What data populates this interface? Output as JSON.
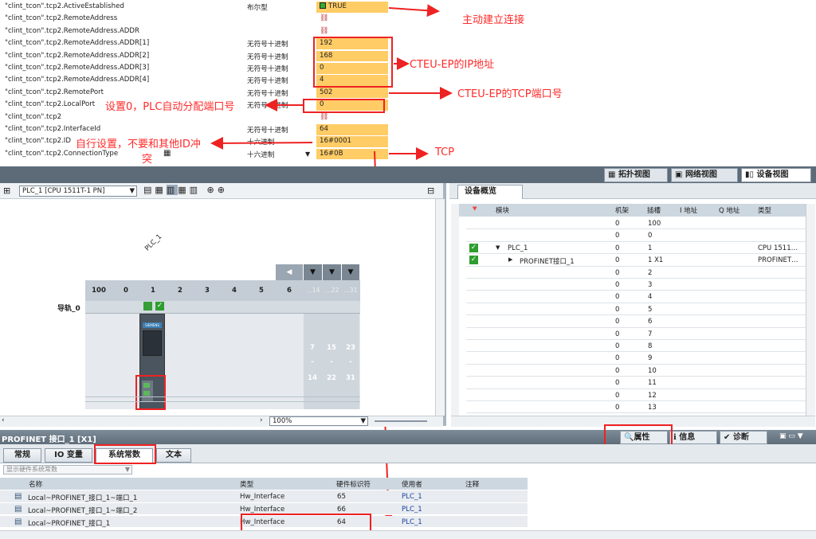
{
  "vars": [
    {
      "name": "\"clint_tcon\".tcp2.ActiveEstablished",
      "type": "布尔型",
      "value": "TRUE",
      "bool": true
    },
    {
      "name": "\"clint_tcon\".tcp2.RemoteAddress",
      "type": "",
      "value": ""
    },
    {
      "name": "\"clint_tcon\".tcp2.RemoteAddress.ADDR",
      "type": "",
      "value": ""
    },
    {
      "name": "\"clint_tcon\".tcp2.RemoteAddress.ADDR[1]",
      "type": "无符号十进制",
      "value": "192"
    },
    {
      "name": "\"clint_tcon\".tcp2.RemoteAddress.ADDR[2]",
      "type": "无符号十进制",
      "value": "168"
    },
    {
      "name": "\"clint_tcon\".tcp2.RemoteAddress.ADDR[3]",
      "type": "无符号十进制",
      "value": "0"
    },
    {
      "name": "\"clint_tcon\".tcp2.RemoteAddress.ADDR[4]",
      "type": "无符号十进制",
      "value": "4"
    },
    {
      "name": "\"clint_tcon\".tcp2.RemotePort",
      "type": "无符号十进制",
      "value": "502"
    },
    {
      "name": "\"clint_tcon\".tcp2.LocalPort",
      "type": "无符号十进制",
      "value": "0"
    },
    {
      "name": "\"clint_tcon\".tcp2",
      "type": "",
      "value": ""
    },
    {
      "name": "\"clint_tcon\".tcp2.InterfaceId",
      "type": "无符号十进制",
      "value": "64"
    },
    {
      "name": "\"clint_tcon\".tcp2.ID",
      "type": "十六进制",
      "value": "16#0001"
    },
    {
      "name": "\"clint_tcon\".tcp2.ConnectionType",
      "type": "十六进制",
      "value": "16#0B"
    }
  ],
  "annotations": {
    "active": "主动建立连接",
    "ip": "CTEU-EP的IP地址",
    "port": "CTEU-EP的TCP端口号",
    "local": "设置0，PLC自动分配端口号",
    "id_line1": "自行设置，不要和其他ID冲",
    "id_line2": "突",
    "tcp": "TCP"
  },
  "view_tabs": {
    "topology": "拓扑视图",
    "network": "网络视图",
    "device": "设备视图"
  },
  "device_view": {
    "plc_select": "PLC_1 [CPU 1511T-1 PN]",
    "zoom": "100%",
    "plc_label": "PLC_1",
    "rail_label": "导轨_0",
    "slot_headers": [
      "100",
      "0",
      "1",
      "2",
      "3",
      "4",
      "5",
      "6",
      "...14",
      "...22",
      "...31"
    ],
    "ext_top": [
      "7",
      "15",
      "23"
    ],
    "ext_dash": [
      "-",
      "-",
      "-"
    ],
    "ext_bot": [
      "14",
      "22",
      "31"
    ],
    "cpu_text": "SIEMENS",
    "scroll_left": "‹",
    "scroll_right": "›"
  },
  "overview": {
    "title": "设备概览",
    "headers": {
      "module": "模块",
      "rack": "机架",
      "slot": "插槽",
      "iaddr": "I 地址",
      "qaddr": "Q 地址",
      "type": "类型"
    },
    "rows": [
      {
        "module": "",
        "rack": "0",
        "slot": "100",
        "type": "",
        "check": false,
        "indent": 0,
        "arrow": ""
      },
      {
        "module": "",
        "rack": "0",
        "slot": "0",
        "type": "",
        "check": false,
        "indent": 0,
        "arrow": ""
      },
      {
        "module": "PLC_1",
        "rack": "0",
        "slot": "1",
        "type": "CPU 1511…",
        "check": true,
        "indent": 1,
        "arrow": "▼"
      },
      {
        "module": "PROFINET接口_1",
        "rack": "0",
        "slot": "1 X1",
        "type": "PROFINET…",
        "check": true,
        "indent": 2,
        "arrow": "▶"
      },
      {
        "module": "",
        "rack": "0",
        "slot": "2",
        "type": "",
        "check": false,
        "indent": 0,
        "arrow": ""
      },
      {
        "module": "",
        "rack": "0",
        "slot": "3",
        "type": "",
        "check": false,
        "indent": 0,
        "arrow": ""
      },
      {
        "module": "",
        "rack": "0",
        "slot": "4",
        "type": "",
        "check": false,
        "indent": 0,
        "arrow": ""
      },
      {
        "module": "",
        "rack": "0",
        "slot": "5",
        "type": "",
        "check": false,
        "indent": 0,
        "arrow": ""
      },
      {
        "module": "",
        "rack": "0",
        "slot": "6",
        "type": "",
        "check": false,
        "indent": 0,
        "arrow": ""
      },
      {
        "module": "",
        "rack": "0",
        "slot": "7",
        "type": "",
        "check": false,
        "indent": 0,
        "arrow": ""
      },
      {
        "module": "",
        "rack": "0",
        "slot": "8",
        "type": "",
        "check": false,
        "indent": 0,
        "arrow": ""
      },
      {
        "module": "",
        "rack": "0",
        "slot": "9",
        "type": "",
        "check": false,
        "indent": 0,
        "arrow": ""
      },
      {
        "module": "",
        "rack": "0",
        "slot": "10",
        "type": "",
        "check": false,
        "indent": 0,
        "arrow": ""
      },
      {
        "module": "",
        "rack": "0",
        "slot": "11",
        "type": "",
        "check": false,
        "indent": 0,
        "arrow": ""
      },
      {
        "module": "",
        "rack": "0",
        "slot": "12",
        "type": "",
        "check": false,
        "indent": 0,
        "arrow": ""
      },
      {
        "module": "",
        "rack": "0",
        "slot": "13",
        "type": "",
        "check": false,
        "indent": 0,
        "arrow": ""
      }
    ]
  },
  "props": {
    "title": "PROFINET 接口_1 [X1]",
    "btn_props": "属性",
    "btn_info": "信息",
    "btn_diag": "诊断",
    "tabs": [
      "常规",
      "IO 变量",
      "系统常数",
      "文本"
    ],
    "filter": "显示硬件系统常数",
    "headers": {
      "name": "名称",
      "type": "类型",
      "hwid": "硬件标识符",
      "user": "使用者",
      "comment": "注释"
    },
    "rows": [
      {
        "name": "Local~PROFINET_接口_1~端口_1",
        "type": "Hw_Interface",
        "hwid": "65",
        "user": "PLC_1"
      },
      {
        "name": "Local~PROFINET_接口_1~端口_2",
        "type": "Hw_Interface",
        "hwid": "66",
        "user": "PLC_1"
      },
      {
        "name": "Local~PROFINET_接口_1",
        "type": "Hw_Interface",
        "hwid": "64",
        "user": "PLC_1"
      }
    ]
  }
}
